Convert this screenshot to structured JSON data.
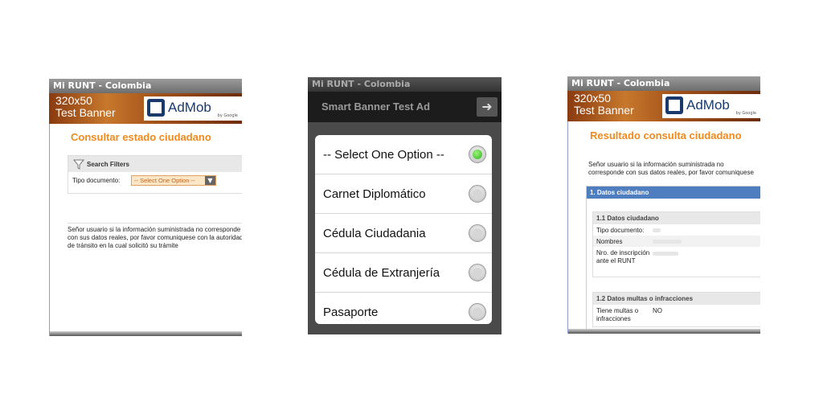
{
  "left": {
    "title": "Mi RUNT - Colombia",
    "banner": {
      "text1": "320x50",
      "text2": "Test Banner",
      "brand": "AdMob",
      "by": "by Google"
    },
    "heading": "Consultar estado ciudadano",
    "filters_label": "Search Filters",
    "tipo_label": "Tipo documento:",
    "select_value": "-- Select One Option --",
    "notice": "Señor usuario si la información suministrada no corresponde con sus datos reales, por favor comuniquese con la autoridad de tránsito en la cual solicitó su trámite"
  },
  "middle": {
    "title": "Mi RUNT - Colombia",
    "ad_text": "Smart Banner Test Ad",
    "options": [
      {
        "label": "-- Select One Option --",
        "selected": true
      },
      {
        "label": "Carnet Diplomático",
        "selected": false
      },
      {
        "label": "Cédula Ciudadania",
        "selected": false
      },
      {
        "label": "Cédula de Extranjería",
        "selected": false
      },
      {
        "label": "Pasaporte",
        "selected": false
      }
    ]
  },
  "right": {
    "title": "Mi RUNT - Colombia",
    "banner": {
      "text1": "320x50",
      "text2": "Test Banner",
      "brand": "AdMob",
      "by": "by Google"
    },
    "heading": "Resultado consulta ciudadano",
    "notice": "Señor usuario si la información suministrada no corresponde con sus datos reales, por favor comuniquese con la autoridad de tránsito en la cual solicitó su trámite",
    "section1": "1. Datos ciudadano",
    "sub11": "1.1 Datos ciudadano",
    "tipo_label": "Tipo documento:",
    "nombres_label": "Nombres",
    "nro_label": "Nro. de inscripción ante el RUNT",
    "sub12": "1.2 Datos multas o infracciones",
    "multas_label": "Tiene multas o infracciones",
    "multas_value": "NO"
  }
}
